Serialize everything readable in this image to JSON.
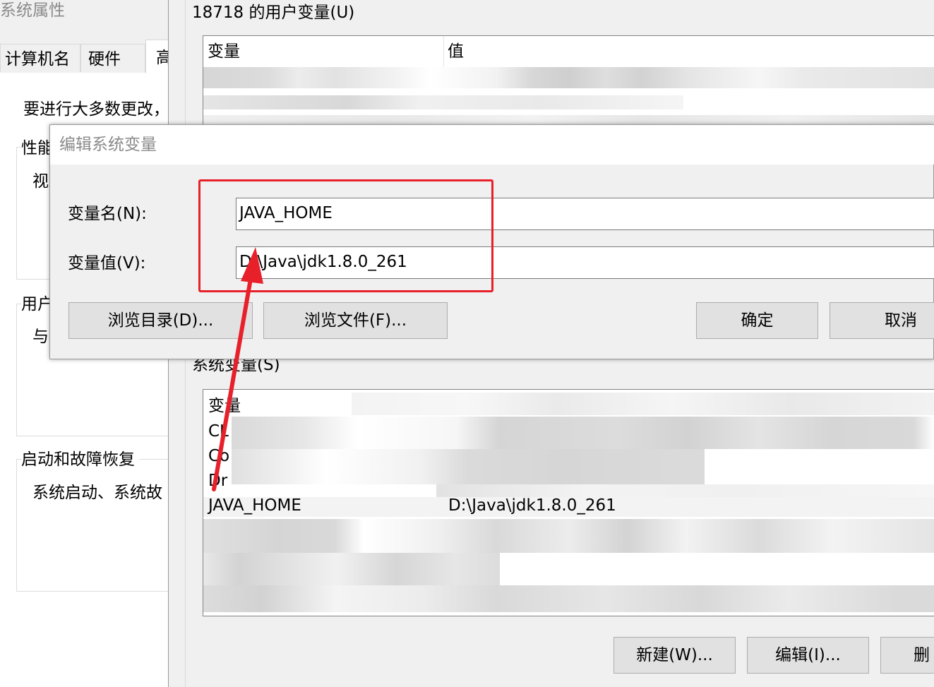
{
  "system_properties": {
    "title": "系统属性",
    "tabs": [
      {
        "label": "计算机名"
      },
      {
        "label": "硬件"
      },
      {
        "label": "高"
      }
    ],
    "admin_note": "要进行大多数更改，",
    "performance": {
      "title": "性能",
      "text": "视"
    },
    "user_profiles": {
      "title": "用户",
      "text": "与"
    },
    "startup_recovery": {
      "title": "启动和故障恢复",
      "text": "系统启动、系统故"
    }
  },
  "env_window": {
    "user_vars_title": "18718 的用户变量(U)",
    "user_vars_columns": {
      "variable": "变量",
      "value": "值"
    },
    "system_vars_title": "系统变量(S)",
    "system_vars_columns": {
      "variable": "变量"
    },
    "system_rows": [
      {
        "name": "CL",
        "value": ""
      },
      {
        "name": "Co",
        "value": ""
      },
      {
        "name": "Dr",
        "value": ""
      },
      {
        "name": "JAVA_HOME",
        "value": "D:\\Java\\jdk1.8.0_261"
      }
    ],
    "buttons": {
      "new": "新建(W)...",
      "edit": "编辑(I)...",
      "delete": "删"
    }
  },
  "edit_dialog": {
    "title": "编辑系统变量",
    "name_label": "变量名(N):",
    "name_value": "JAVA_HOME",
    "value_label": "变量值(V):",
    "value_value": "D:\\Java\\jdk1.8.0_261",
    "buttons": {
      "browse_dir": "浏览目录(D)...",
      "browse_file": "浏览文件(F)...",
      "ok": "确定",
      "cancel": "取消"
    }
  },
  "annotation": {
    "highlight_color": "#e8202a"
  }
}
